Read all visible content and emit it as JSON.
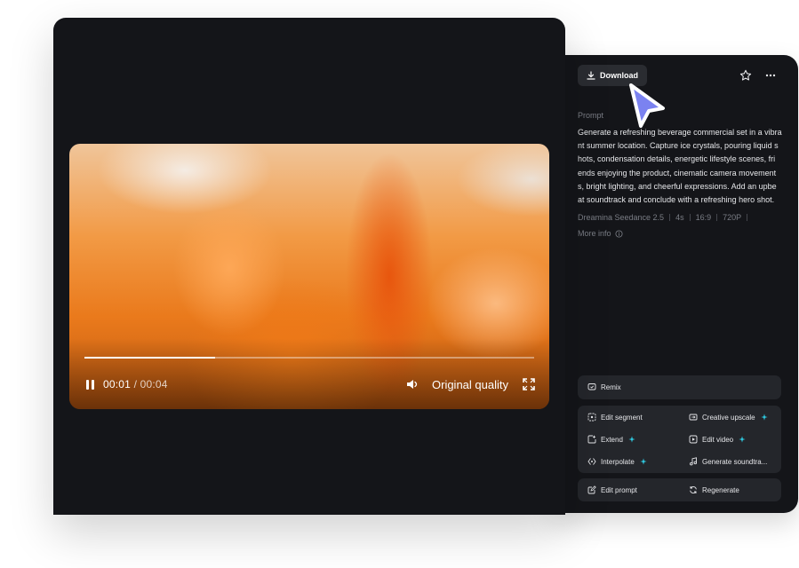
{
  "player": {
    "current_time": "00:01",
    "time_separator": " / ",
    "total_time": "00:04",
    "quality_label": "Original quality",
    "progress_fraction": 0.29
  },
  "panel": {
    "download_label": "Download",
    "prompt_label": "Prompt",
    "prompt_text": "Generate a refreshing beverage commercial set in a vibra\nnt summer location. Capture ice crystals, pouring liquid s\nhots, condensation details, energetic lifestyle scenes, fri\nends enjoying the product, cinematic camera movement\ns, bright lighting, and cheerful expressions. Add an upbe\nat soundtrack and conclude with a refreshing hero shot.",
    "meta": [
      "Dreamina Seedance 2.5",
      "4s",
      "16:9",
      "720P"
    ],
    "more_info_label": "More info"
  },
  "actions": {
    "remix": "Remix",
    "edit_segment": "Edit segment",
    "creative_upscale": "Creative upscale",
    "extend": "Extend",
    "edit_video": "Edit video",
    "interpolate": "Interpolate",
    "generate_soundtrack": "Generate soundtra...",
    "edit_prompt": "Edit prompt",
    "regenerate": "Regenerate"
  },
  "colors": {
    "panel_bg": "#141519",
    "button_bg": "#24262b",
    "sparkle": "#2fd0e8",
    "cursor": "#7b82f0"
  }
}
